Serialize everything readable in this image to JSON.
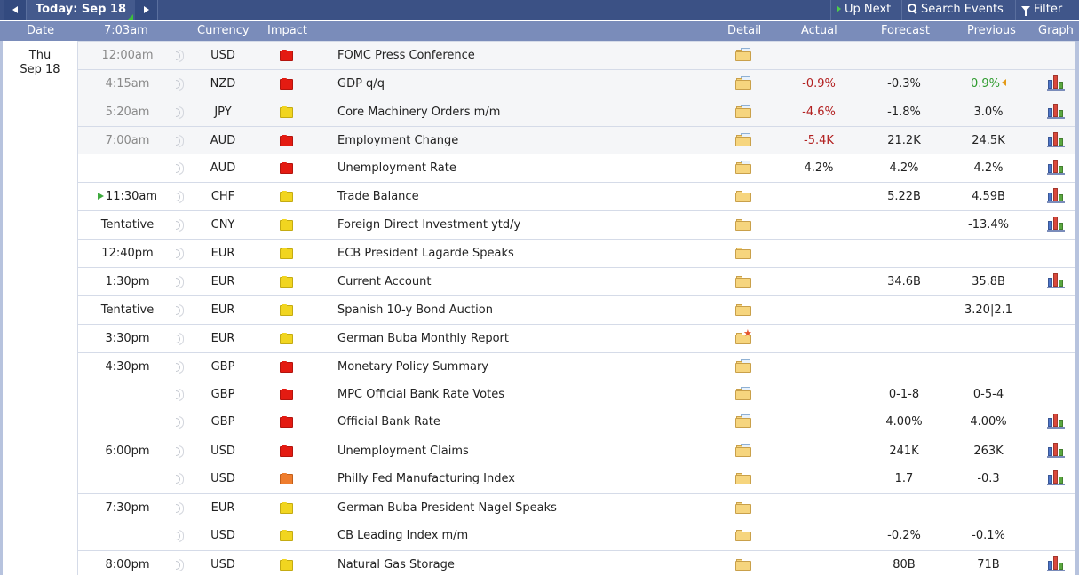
{
  "toolbar": {
    "today_label": "Today: Sep 18",
    "up_next_label": "Up Next",
    "search_label": "Search Events",
    "filter_label": "Filter"
  },
  "header": {
    "date": "Date",
    "time": "7:03am",
    "currency": "Currency",
    "impact": "Impact",
    "detail": "Detail",
    "actual": "Actual",
    "forecast": "Forecast",
    "previous": "Previous",
    "graph": "Graph"
  },
  "date_block": {
    "day": "Thu",
    "date": "Sep 18"
  },
  "colors": {
    "topbar": "#3b5185",
    "header": "#7a8cba",
    "negative": "#b21f1f",
    "positive": "#2c9a2c",
    "impact_high": "#e41b12",
    "impact_medium": "#f1d520",
    "impact_medium_high": "#ef7d2e"
  },
  "rows": [
    {
      "time": "12:00am",
      "currency": "USD",
      "impact": "high",
      "event": "FOMC Press Conference",
      "actual": "",
      "forecast": "",
      "previous": "",
      "detail_icon": "folder-doc-icon",
      "graph": false,
      "past": true,
      "border": true
    },
    {
      "time": "4:15am",
      "currency": "NZD",
      "impact": "high",
      "event": "GDP q/q",
      "actual": "-0.9%",
      "actual_class": "neg",
      "forecast": "-0.3%",
      "previous": "0.9%",
      "previous_class": "pos",
      "previous_revised": true,
      "detail_icon": "folder-doc-icon",
      "graph": true,
      "past": true,
      "border": true
    },
    {
      "time": "5:20am",
      "currency": "JPY",
      "impact": "medium",
      "event": "Core Machinery Orders m/m",
      "actual": "-4.6%",
      "actual_class": "neg",
      "forecast": "-1.8%",
      "previous": "3.0%",
      "detail_icon": "folder-doc-icon",
      "graph": true,
      "past": true,
      "border": true
    },
    {
      "time": "7:00am",
      "currency": "AUD",
      "impact": "high",
      "event": "Employment Change",
      "actual": "-5.4K",
      "actual_class": "neg",
      "forecast": "21.2K",
      "previous": "24.5K",
      "detail_icon": "folder-doc-icon",
      "graph": true,
      "past": true,
      "border": true
    },
    {
      "time": "",
      "currency": "AUD",
      "impact": "high",
      "event": "Unemployment Rate",
      "actual": "4.2%",
      "forecast": "4.2%",
      "previous": "4.2%",
      "detail_icon": "folder-doc-icon",
      "graph": true,
      "past": false,
      "border": false
    },
    {
      "time": "11:30am",
      "time_marker": true,
      "currency": "CHF",
      "impact": "medium",
      "event": "Trade Balance",
      "actual": "",
      "forecast": "5.22B",
      "previous": "4.59B",
      "detail_icon": "folder-icon",
      "graph": true,
      "past": false,
      "border": true
    },
    {
      "time": "Tentative",
      "currency": "CNY",
      "impact": "medium",
      "event": "Foreign Direct Investment ytd/y",
      "actual": "",
      "forecast": "",
      "previous": "-13.4%",
      "detail_icon": "folder-icon",
      "graph": true,
      "past": false,
      "border": true
    },
    {
      "time": "12:40pm",
      "currency": "EUR",
      "impact": "medium",
      "event": "ECB President Lagarde Speaks",
      "actual": "",
      "forecast": "",
      "previous": "",
      "detail_icon": "folder-icon",
      "graph": false,
      "past": false,
      "border": true
    },
    {
      "time": "1:30pm",
      "currency": "EUR",
      "impact": "medium",
      "event": "Current Account",
      "actual": "",
      "forecast": "34.6B",
      "previous": "35.8B",
      "detail_icon": "folder-icon",
      "graph": true,
      "past": false,
      "border": true
    },
    {
      "time": "Tentative",
      "currency": "EUR",
      "impact": "medium",
      "event": "Spanish 10-y Bond Auction",
      "actual": "",
      "forecast": "",
      "previous": "3.20|2.1",
      "detail_icon": "folder-icon",
      "graph": false,
      "past": false,
      "border": true
    },
    {
      "time": "3:30pm",
      "currency": "EUR",
      "impact": "medium",
      "event": "German Buba Monthly Report",
      "actual": "",
      "forecast": "",
      "previous": "",
      "detail_icon": "folder-star-icon",
      "graph": false,
      "past": false,
      "border": true
    },
    {
      "time": "4:30pm",
      "currency": "GBP",
      "impact": "high",
      "event": "Monetary Policy Summary",
      "actual": "",
      "forecast": "",
      "previous": "",
      "detail_icon": "folder-doc-icon",
      "graph": false,
      "past": false,
      "border": true
    },
    {
      "time": "",
      "currency": "GBP",
      "impact": "high",
      "event": "MPC Official Bank Rate Votes",
      "actual": "",
      "forecast": "0-1-8",
      "previous": "0-5-4",
      "detail_icon": "folder-doc-icon",
      "graph": false,
      "past": false,
      "border": false
    },
    {
      "time": "",
      "currency": "GBP",
      "impact": "high",
      "event": "Official Bank Rate",
      "actual": "",
      "forecast": "4.00%",
      "previous": "4.00%",
      "detail_icon": "folder-doc-icon",
      "graph": true,
      "past": false,
      "border": false
    },
    {
      "time": "6:00pm",
      "currency": "USD",
      "impact": "high",
      "event": "Unemployment Claims",
      "actual": "",
      "forecast": "241K",
      "previous": "263K",
      "detail_icon": "folder-doc-icon",
      "graph": true,
      "past": false,
      "border": true
    },
    {
      "time": "",
      "currency": "USD",
      "impact": "medium-high",
      "event": "Philly Fed Manufacturing Index",
      "actual": "",
      "forecast": "1.7",
      "previous": "-0.3",
      "detail_icon": "folder-icon",
      "graph": true,
      "past": false,
      "border": false
    },
    {
      "time": "7:30pm",
      "currency": "EUR",
      "impact": "medium",
      "event": "German Buba President Nagel Speaks",
      "actual": "",
      "forecast": "",
      "previous": "",
      "detail_icon": "folder-icon",
      "graph": false,
      "past": false,
      "border": true
    },
    {
      "time": "",
      "currency": "USD",
      "impact": "medium",
      "event": "CB Leading Index m/m",
      "actual": "",
      "forecast": "-0.2%",
      "previous": "-0.1%",
      "detail_icon": "folder-icon",
      "graph": false,
      "past": false,
      "border": false
    },
    {
      "time": "8:00pm",
      "currency": "USD",
      "impact": "medium",
      "event": "Natural Gas Storage",
      "actual": "",
      "forecast": "80B",
      "previous": "71B",
      "detail_icon": "folder-icon",
      "graph": true,
      "past": false,
      "border": true
    }
  ]
}
